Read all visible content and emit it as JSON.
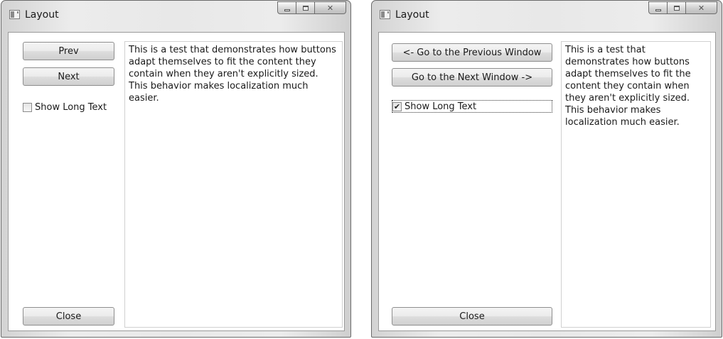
{
  "windows": [
    {
      "title": "Layout",
      "buttons": {
        "prev": "Prev",
        "next": "Next",
        "close": "Close"
      },
      "checkbox": {
        "label": "Show Long Text",
        "checked": false
      },
      "textbox": {
        "text": "This is a test that demonstrates how buttons adapt themselves to fit the content they contain when they aren't explicitly sized. This behavior makes localization much easier."
      }
    },
    {
      "title": "Layout",
      "buttons": {
        "prev": "<- Go to the Previous Window",
        "next": "Go to the Next Window ->",
        "close": "Close"
      },
      "checkbox": {
        "label": "Show Long Text",
        "checked": true
      },
      "textbox": {
        "text": "This is a test that demonstrates how buttons adapt themselves to fit the content they contain when they aren't explicitly sized. This behavior makes localization much easier."
      }
    }
  ],
  "icons": {
    "minimize": "minimize-icon",
    "maximize": "maximize-icon",
    "close": "close-icon",
    "checkmark": "checkmark-icon",
    "app": "window-app-icon"
  }
}
